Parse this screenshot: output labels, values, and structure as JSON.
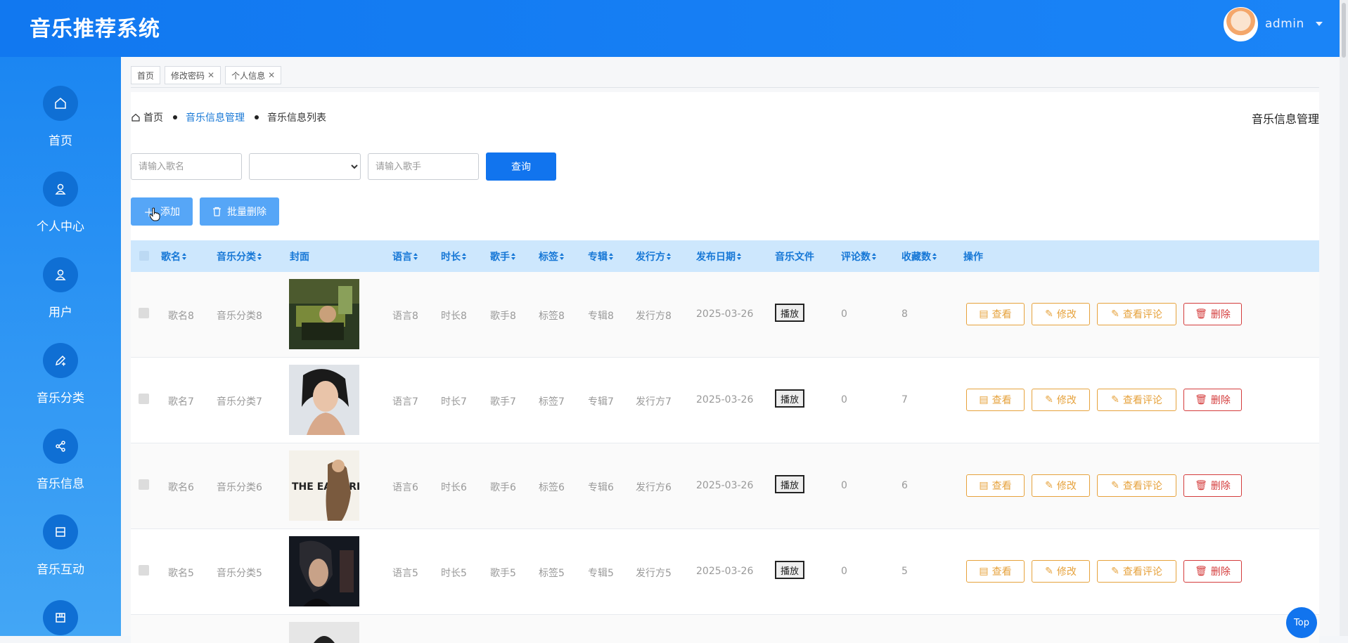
{
  "app": {
    "title": "音乐推荐系统"
  },
  "user": {
    "name": "admin"
  },
  "sidebar": {
    "items": [
      {
        "label": "首页",
        "icon": "home-icon"
      },
      {
        "label": "个人中心",
        "icon": "user-icon"
      },
      {
        "label": "用户",
        "icon": "user-icon"
      },
      {
        "label": "音乐分类",
        "icon": "edit-icon"
      },
      {
        "label": "音乐信息",
        "icon": "share-icon"
      },
      {
        "label": "音乐互动",
        "icon": "box-icon"
      },
      {
        "label": "",
        "icon": "grid-icon"
      }
    ]
  },
  "tabs": [
    {
      "label": "首页"
    },
    {
      "label": "修改密码"
    },
    {
      "label": "个人信息"
    }
  ],
  "breadcrumb": {
    "home": "首页",
    "section": "音乐信息管理",
    "current": "音乐信息列表"
  },
  "page_heading": "音乐信息管理",
  "search": {
    "song_placeholder": "请输入歌名",
    "singer_placeholder": "请输入歌手",
    "query_label": "查询"
  },
  "actions": {
    "add_label": "添加",
    "batch_delete_label": "批量删除"
  },
  "table": {
    "headers": {
      "name": "歌名",
      "category": "音乐分类",
      "cover": "封面",
      "language": "语言",
      "duration": "时长",
      "singer": "歌手",
      "tag": "标签",
      "album": "专辑",
      "publisher": "发行方",
      "release_date": "发布日期",
      "file": "音乐文件",
      "comments": "评论数",
      "favorites": "收藏数",
      "ops": "操作"
    },
    "play_label": "播放",
    "op_labels": {
      "view": "查看",
      "edit": "修改",
      "comments": "查看评论",
      "delete": "删除"
    },
    "rows": [
      {
        "name": "歌名8",
        "category": "音乐分类8",
        "language": "语言8",
        "duration": "时长8",
        "singer": "歌手8",
        "tag": "标签8",
        "album": "专辑8",
        "publisher": "发行方8",
        "release_date": "2025-03-26",
        "comments": "0",
        "favorites": "8"
      },
      {
        "name": "歌名7",
        "category": "音乐分类7",
        "language": "语言7",
        "duration": "时长7",
        "singer": "歌手7",
        "tag": "标签7",
        "album": "专辑7",
        "publisher": "发行方7",
        "release_date": "2025-03-26",
        "comments": "0",
        "favorites": "7"
      },
      {
        "name": "歌名6",
        "category": "音乐分类6",
        "language": "语言6",
        "duration": "时长6",
        "singer": "歌手6",
        "tag": "标签6",
        "album": "专辑6",
        "publisher": "发行方6",
        "release_date": "2025-03-26",
        "comments": "0",
        "favorites": "6"
      },
      {
        "name": "歌名5",
        "category": "音乐分类5",
        "language": "语言5",
        "duration": "时长5",
        "singer": "歌手5",
        "tag": "标签5",
        "album": "专辑5",
        "publisher": "发行方5",
        "release_date": "2025-03-26",
        "comments": "0",
        "favorites": "5"
      }
    ]
  },
  "cover_art_text": "THE EASY RIDE",
  "top_button": "Top",
  "colors": {
    "primary": "#1174ee",
    "header": "#1178f0",
    "warning": "#e6a23c",
    "danger": "#d43c3c",
    "table_header": "#cde7fd"
  }
}
